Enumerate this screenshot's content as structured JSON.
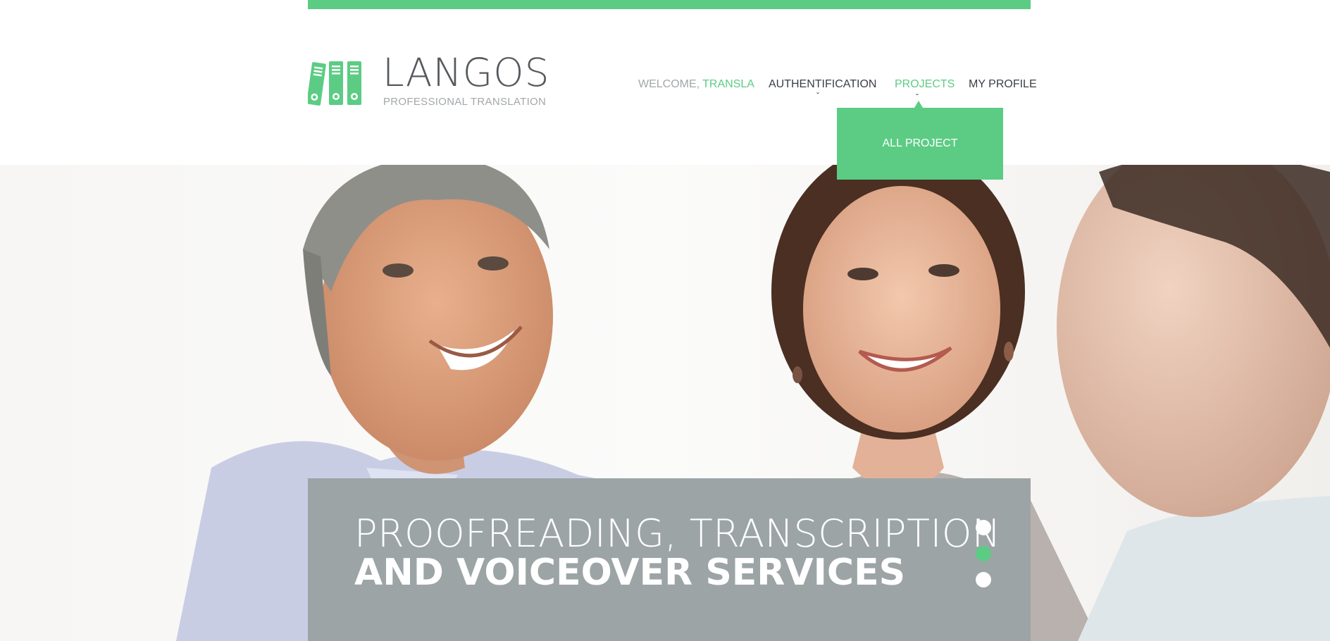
{
  "brand": {
    "title": "LANGOS",
    "subtitle": "PROFESSIONAL TRANSLATION",
    "logo_icon": "binders-icon",
    "accent_color": "#5ccc84"
  },
  "nav": {
    "welcome_prefix": "WELCOME,",
    "welcome_user": "TRANSLA",
    "items": [
      {
        "label": "AUTHENTIFICATION",
        "has_dropdown": true
      },
      {
        "label": "PROJECTS",
        "has_dropdown": true,
        "active": true
      },
      {
        "label": "MY PROFILE",
        "has_dropdown": false
      }
    ],
    "caret_glyph": "ˇ"
  },
  "dropdown": {
    "items": [
      {
        "label": "ALL PROJECT"
      }
    ]
  },
  "hero": {
    "image": "three-smiling-business-people-photo",
    "caption_line1": "PROOFREADING, TRANSCRIPTION",
    "caption_line2": "AND VOICEOVER SERVICES",
    "slides": 3,
    "active_slide": 2,
    "caption_bg": "#9ca4a6"
  }
}
